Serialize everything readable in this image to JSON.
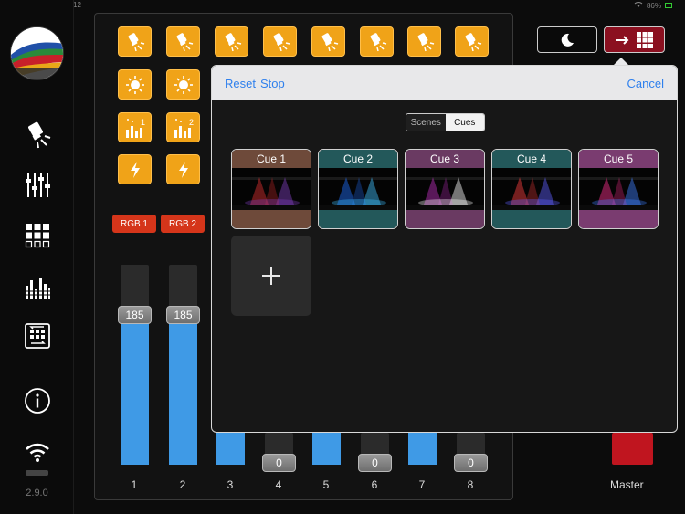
{
  "status": {
    "time": "12",
    "battery": "86%"
  },
  "sidebar": {
    "version": "2.9.0",
    "items": [
      {
        "name": "fixture-icon"
      },
      {
        "name": "faders-icon"
      },
      {
        "name": "grid-icon"
      },
      {
        "name": "equalizer-icon"
      },
      {
        "name": "cues-icon"
      },
      {
        "name": "info-icon"
      },
      {
        "name": "wifi-icon"
      }
    ]
  },
  "scenes": {
    "row1_icon": "spot-light-icon",
    "sun_icon": "sun-icon",
    "bars": [
      {
        "badge": "1"
      },
      {
        "badge": "2"
      }
    ],
    "flash_icon": "lightning-icon"
  },
  "rgb": {
    "buttons": [
      "RGB 1",
      "RGB 2"
    ]
  },
  "faders": [
    {
      "num": "1",
      "value": "185",
      "level": 0.73
    },
    {
      "num": "2",
      "value": "185",
      "level": 0.73
    },
    {
      "num": "3",
      "value": "",
      "level": 0.2
    },
    {
      "num": "4",
      "value": "0",
      "level": 0
    },
    {
      "num": "5",
      "value": "",
      "level": 0.2
    },
    {
      "num": "6",
      "value": "0",
      "level": 0
    },
    {
      "num": "7",
      "value": "",
      "level": 0.2
    },
    {
      "num": "8",
      "value": "0",
      "level": 0
    }
  ],
  "master": {
    "label": "Master",
    "color": "#c0151f"
  },
  "popover": {
    "reset": "Reset",
    "stop": "Stop",
    "cancel": "Cancel",
    "segments": {
      "scenes": "Scenes",
      "cues": "Cues",
      "selected": "Cues"
    },
    "cues": [
      {
        "label": "Cue 1",
        "color": "#6e4a3a"
      },
      {
        "label": "Cue 2",
        "color": "#23585a"
      },
      {
        "label": "Cue 3",
        "color": "#6a3a62"
      },
      {
        "label": "Cue 4",
        "color": "#23585a"
      },
      {
        "label": "Cue 5",
        "color": "#7a3c70"
      }
    ]
  },
  "colors": {
    "accent_orange": "#f0a318",
    "accent_blue": "#3f9ae6",
    "link": "#2f80ed",
    "rgb_red": "#d5351a"
  }
}
